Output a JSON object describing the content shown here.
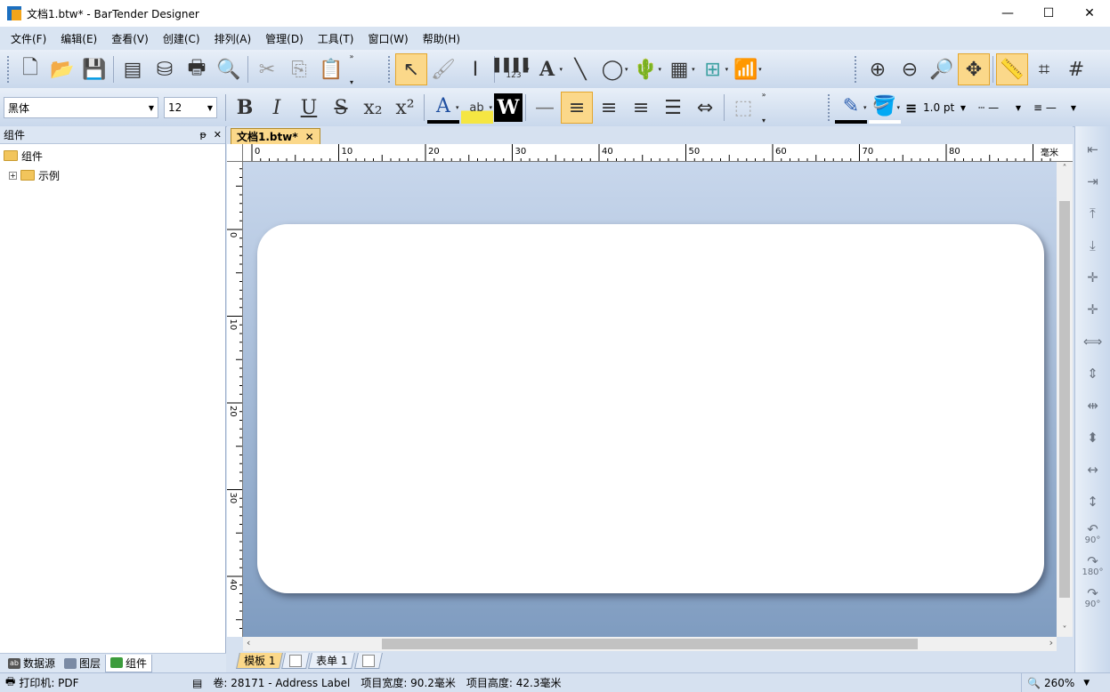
{
  "window": {
    "title": "文档1.btw* - BarTender Designer",
    "minimize": "—",
    "maximize": "☐",
    "close": "✕"
  },
  "menu": [
    "文件(F)",
    "编辑(E)",
    "查看(V)",
    "创建(C)",
    "排列(A)",
    "管理(D)",
    "工具(T)",
    "窗口(W)",
    "帮助(H)"
  ],
  "format_toolbar": {
    "font_name": "黑体",
    "font_size": "12",
    "bold": "B",
    "italic": "I",
    "underline": "U",
    "strikethrough": "S",
    "subscript": "x₂",
    "superscript": "x²",
    "font_color": "A",
    "highlight": "ab",
    "white_text": "W",
    "line_width": "1.0 pt"
  },
  "main_toolbar": {
    "barcode_caption": "123",
    "text_tool": "A"
  },
  "left_panel": {
    "title": "组件",
    "pin": "ᵽ",
    "close": "✕",
    "tree": [
      {
        "label": "组件"
      },
      {
        "label": "示例"
      }
    ],
    "tabs": [
      {
        "label": "数据源"
      },
      {
        "label": "图层"
      },
      {
        "label": "组件"
      }
    ]
  },
  "document": {
    "tab_label": "文档1.btw*",
    "tab_close": "✕",
    "ruler_unit": "毫米",
    "h_ruler_labels": [
      "0",
      "10",
      "20",
      "30",
      "40",
      "50",
      "60",
      "70",
      "80"
    ],
    "v_ruler_labels": [
      "0",
      "10",
      "20",
      "30",
      "40"
    ],
    "sheet_tabs": [
      {
        "label": "模板 1"
      },
      {
        "label": "表单 1"
      }
    ]
  },
  "right_toolbar": {
    "rotate_labels": [
      "90°",
      "180°",
      "90°"
    ]
  },
  "status": {
    "printer": "打印机: PDF",
    "stock": "卷: 28171 - Address Label",
    "item_width": "项目宽度: 90.2毫米",
    "item_height": "项目高度: 42.3毫米",
    "zoom": "260%"
  },
  "colors": {
    "accent": "#fbd88a",
    "toolbar_bg": "#d6e1f0",
    "canvas_top": "#c8d7ec",
    "canvas_bottom": "#7f9cc0"
  }
}
